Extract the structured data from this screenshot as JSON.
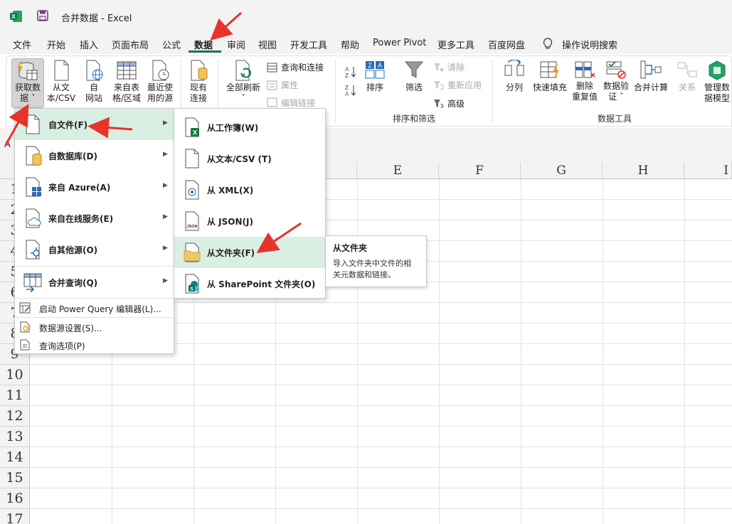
{
  "window": {
    "title": "合并数据  -  Excel"
  },
  "menu_tabs": [
    {
      "label": "文件"
    },
    {
      "label": "开始"
    },
    {
      "label": "插入"
    },
    {
      "label": "页面布局"
    },
    {
      "label": "公式"
    },
    {
      "label": "数据",
      "active": true
    },
    {
      "label": "审阅"
    },
    {
      "label": "视图"
    },
    {
      "label": "开发工具"
    },
    {
      "label": "帮助"
    },
    {
      "label": "Power Pivot"
    },
    {
      "label": "更多工具"
    },
    {
      "label": "百度网盘"
    },
    {
      "label": "操作说明搜索"
    }
  ],
  "ribbon": {
    "get_data": {
      "line1": "获取数",
      "line2": "据 ˇ"
    },
    "from_text_csv": {
      "line1": "从文",
      "line2": "本/CSV"
    },
    "from_web": {
      "line1": "自",
      "line2": "网站"
    },
    "from_table": {
      "line1": "来自表",
      "line2": "格/区域"
    },
    "recent_sources": {
      "line1": "最近使",
      "line2": "用的源"
    },
    "existing_conn": {
      "line1": "现有",
      "line2": "连接"
    },
    "refresh_all": {
      "line1": "全部刷新",
      "line2": "ˇ"
    },
    "queries_conn": "查询和连接",
    "properties": "属性",
    "edit_links": "编辑链接",
    "sort_asc": "A↓Z",
    "sort": "排序",
    "filter": "筛选",
    "clear": "清除",
    "reapply": "重新应用",
    "advanced": "高级",
    "split": "分列",
    "flash_fill": "快速填充",
    "remove_dup": {
      "line1": "删除",
      "line2": "重复值"
    },
    "data_valid": {
      "line1": "数据验",
      "line2": "证 ˇ"
    },
    "consolidate": "合并计算",
    "relations": "关系",
    "manage_model": {
      "line1": "管理数",
      "line2": "据模型"
    },
    "group_sort_filter": "排序和筛选",
    "group_data_tools": "数据工具"
  },
  "namebox_stub": "A",
  "columns": [
    "E",
    "F",
    "G",
    "H",
    "I"
  ],
  "rows": [
    "1",
    "2",
    "3",
    "4",
    "5",
    "6",
    "7",
    "8",
    "9",
    "10",
    "11",
    "12",
    "13",
    "14",
    "15",
    "16",
    "17"
  ],
  "get_data_menu": {
    "items": [
      {
        "label": "自文件(F)"
      },
      {
        "label": "自数据库(D)"
      },
      {
        "label": "来自 Azure(A)"
      },
      {
        "label": "来自在线服务(E)"
      },
      {
        "label": "自其他源(O)"
      },
      {
        "label": "合并查询(Q)"
      }
    ],
    "commands": [
      {
        "label": "启动 Power Query 编辑器(L)..."
      },
      {
        "label": "数据源设置(S)..."
      },
      {
        "label": "查询选项(P)"
      }
    ]
  },
  "from_file_menu": {
    "items": [
      {
        "label": "从工作簿(W)"
      },
      {
        "label": "从文本/CSV (T)"
      },
      {
        "label": "从 XML(X)"
      },
      {
        "label": "从 JSON(J)"
      },
      {
        "label": "从文件夹(F)"
      },
      {
        "label": "从 SharePoint 文件夹(O)"
      }
    ]
  },
  "tooltip": {
    "title": "从文件夹",
    "line1": "导入文件夹中文件的相",
    "line2": "关元数据和链接。"
  },
  "colors": {
    "accent_green": "#217346",
    "highlight": "#d9efe3",
    "annotation_red": "#e8332b"
  }
}
